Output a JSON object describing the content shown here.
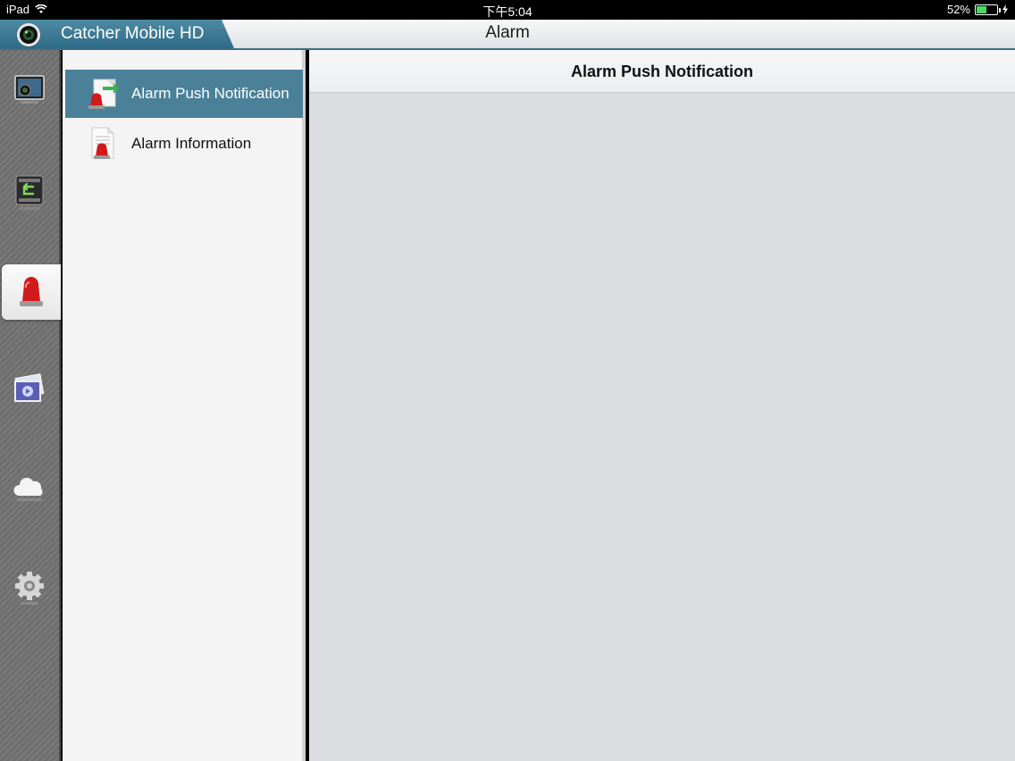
{
  "status_bar": {
    "device": "iPad",
    "time": "下午5:04",
    "battery_percent": "52%",
    "battery_level": 0.52
  },
  "title_bar": {
    "app_name": "Catcher Mobile HD",
    "page_title": "Alarm"
  },
  "rail": {
    "items": [
      {
        "name": "live-view",
        "icon": "monitor-camera-icon"
      },
      {
        "name": "playback",
        "icon": "film-replay-icon"
      },
      {
        "name": "alarm",
        "icon": "siren-icon",
        "active": true
      },
      {
        "name": "gallery",
        "icon": "photo-video-icon"
      },
      {
        "name": "cloud",
        "icon": "cloud-icon"
      },
      {
        "name": "settings",
        "icon": "gear-icon"
      }
    ]
  },
  "list": {
    "items": [
      {
        "label": "Alarm Push Notification",
        "icon": "alarm-push-icon",
        "selected": true
      },
      {
        "label": "Alarm Information",
        "icon": "alarm-document-icon",
        "selected": false
      }
    ]
  },
  "detail": {
    "header": "Alarm Push Notification"
  },
  "colors": {
    "brand": "#2e6b86",
    "selected": "#4a8199",
    "alarm_red": "#d11a1a"
  }
}
